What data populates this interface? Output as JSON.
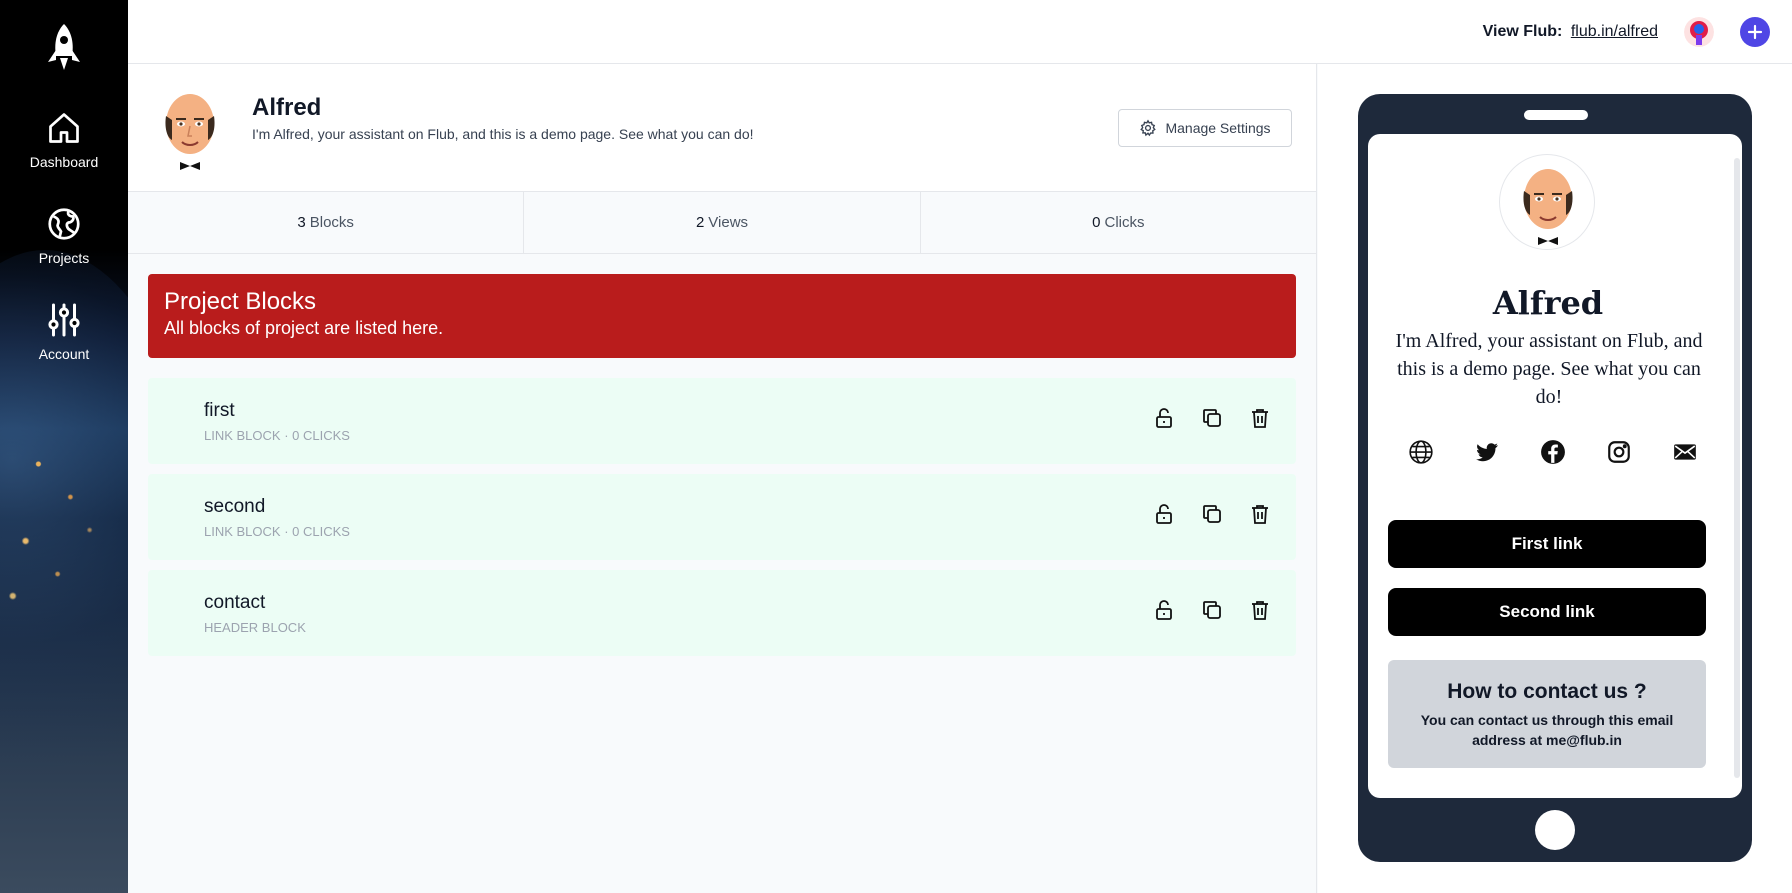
{
  "sidebar": {
    "items": [
      {
        "label": "Dashboard",
        "icon": "home-icon"
      },
      {
        "label": "Projects",
        "icon": "globe-icon"
      },
      {
        "label": "Account",
        "icon": "sliders-icon"
      }
    ]
  },
  "topbar": {
    "view_label": "View Flub:",
    "view_link": "flub.in/alfred"
  },
  "profile": {
    "name": "Alfred",
    "bio": "I'm Alfred, your assistant on Flub, and this is a demo page. See what you can do!",
    "manage_label": "Manage Settings"
  },
  "stats": [
    {
      "value": "3",
      "unit": "Blocks"
    },
    {
      "value": "2",
      "unit": "Views"
    },
    {
      "value": "0",
      "unit": "Clicks"
    }
  ],
  "banner": {
    "title": "Project Blocks",
    "subtitle": "All blocks of project are listed here."
  },
  "blocks": [
    {
      "name": "first",
      "meta": "Link Block · 0 Clicks"
    },
    {
      "name": "second",
      "meta": "Link Block · 0 Clicks"
    },
    {
      "name": "contact",
      "meta": "Header Block"
    }
  ],
  "preview": {
    "name": "Alfred",
    "bio": "I'm Alfred, your assistant on Flub, and this is a demo page. See what you can do!",
    "links": [
      "First link",
      "Second link"
    ],
    "card_title": "How to contact us ?",
    "card_text": "You can contact us through this email address at me@flub.in"
  },
  "colors": {
    "accent": "#4f46e5",
    "banner": "#b91c1c",
    "block_bg": "#ecfdf5",
    "phone": "#1e293b"
  }
}
